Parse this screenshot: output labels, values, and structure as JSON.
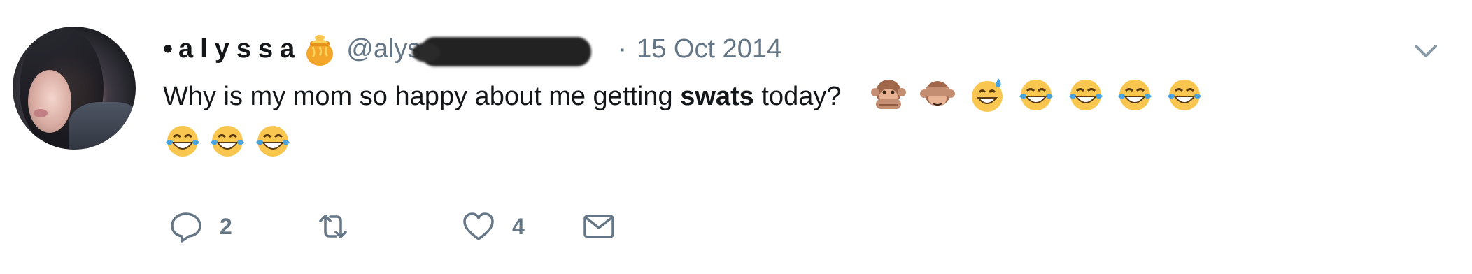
{
  "tweet": {
    "author": {
      "bullet": "•",
      "display_name": "alyssa",
      "name_emoji": "honey-pot",
      "handle_visible": "@alys",
      "handle_redacted": true
    },
    "separator": "·",
    "date": "15 Oct 2014",
    "text_before": "Why is my mom so happy about me getting ",
    "text_bold": "swats",
    "text_after": " today?",
    "emojis": [
      "speak-no-evil-monkey",
      "see-no-evil-monkey",
      "grinning-face-with-sweat",
      "face-with-tears-of-joy",
      "face-with-tears-of-joy",
      "face-with-tears-of-joy",
      "face-with-tears-of-joy",
      "face-with-tears-of-joy",
      "face-with-tears-of-joy",
      "face-with-tears-of-joy"
    ],
    "actions": {
      "reply_count": "2",
      "like_count": "4"
    }
  },
  "colors": {
    "text": "#14171a",
    "secondary": "#657786",
    "emoji_yellow": "#f9c74f",
    "tear_blue": "#4aa3df"
  }
}
